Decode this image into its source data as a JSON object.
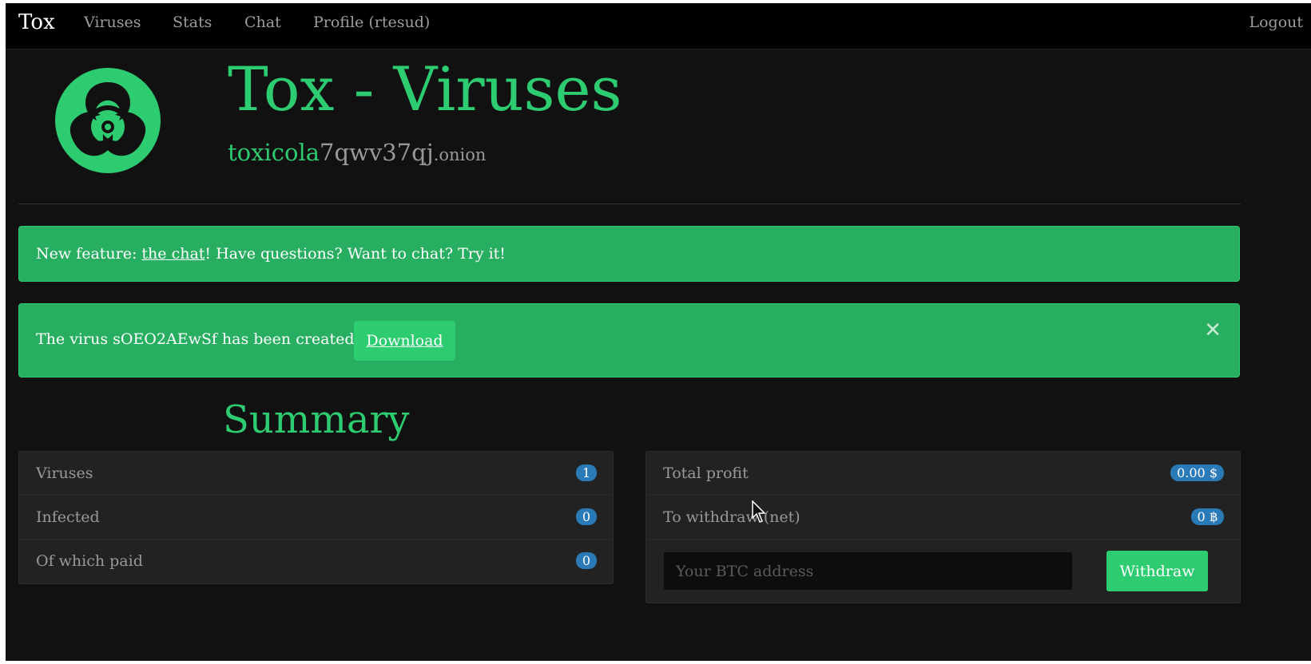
{
  "nav": {
    "brand": "Tox",
    "links": [
      "Viruses",
      "Stats",
      "Chat",
      "Profile (rtesud)"
    ],
    "logout": "Logout"
  },
  "header": {
    "title": "Tox - Viruses",
    "onion_green": "toxicola",
    "onion_gray": "7qwv37qj",
    "onion_tld": ".onion",
    "logo_icon": "biohazard-icon"
  },
  "alerts": {
    "feature_prefix": "New feature: ",
    "feature_link": "the chat",
    "feature_suffix": "! Have questions? Want to chat? Try it!",
    "virus_text": "The virus sOEO2AEwSf has been created:",
    "download_label": "Download",
    "close_symbol": "✕"
  },
  "summary": {
    "title": "Summary",
    "left_rows": [
      {
        "label": "Viruses",
        "value": "1"
      },
      {
        "label": "Infected",
        "value": "0"
      },
      {
        "label": "Of which paid",
        "value": "0"
      }
    ],
    "right_rows": [
      {
        "label": "Total profit",
        "value": "0.00 $"
      },
      {
        "label": "To withdraw (net)",
        "value": "0 ฿"
      }
    ],
    "btc_placeholder": "Your BTC address",
    "withdraw_label": "Withdraw"
  },
  "colors": {
    "accent": "#2ecc71",
    "alert_bg": "#27ae60",
    "badge": "#2a7ab8",
    "background": "#111111"
  }
}
